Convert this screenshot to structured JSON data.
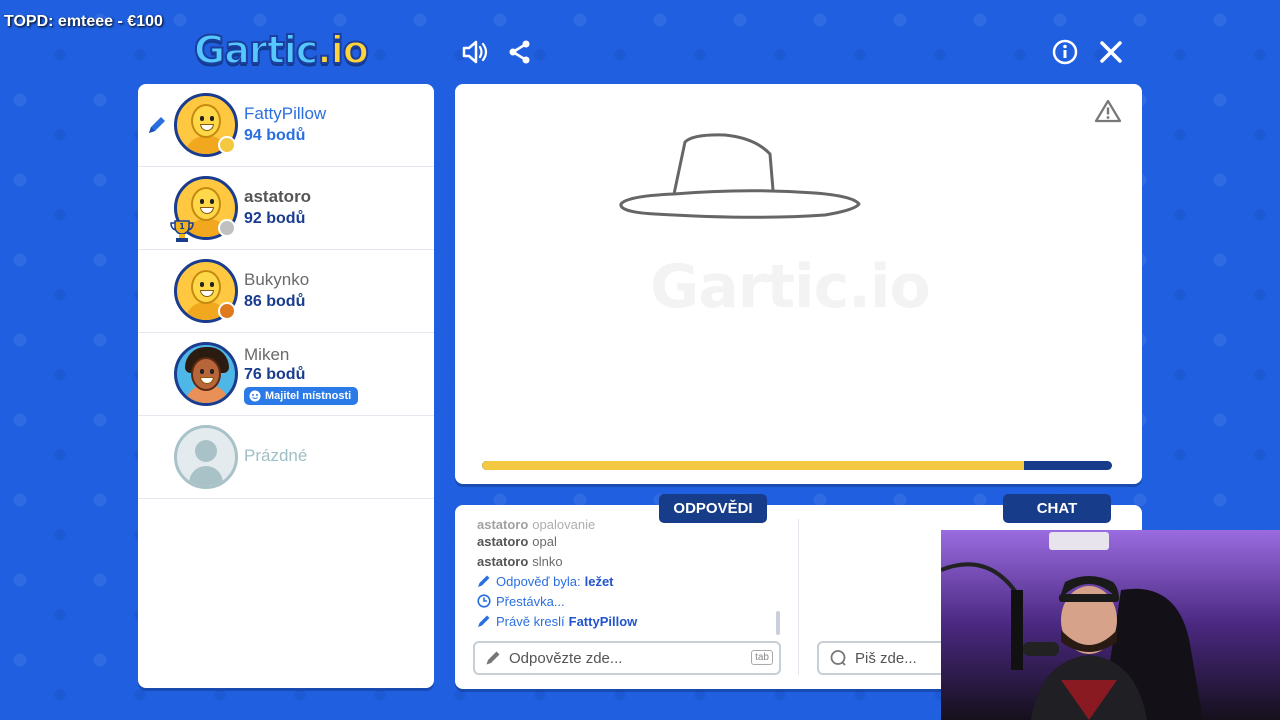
{
  "overlay": {
    "text": "TOPD: emteee - €100"
  },
  "header": {
    "logo_main": "Gartic",
    "logo_suffix": ".io"
  },
  "players": [
    {
      "name": "FattyPillow",
      "score": "94 bodů",
      "drawing": true,
      "status_color": "#f5c842"
    },
    {
      "name": "astatoro",
      "score": "92 bodů",
      "rank": "1",
      "status_color": "#c0c0c0"
    },
    {
      "name": "Bukynko",
      "score": "86 bodů",
      "status_color": "#e07a1e"
    },
    {
      "name": "Miken",
      "score": "76 bodů",
      "badge": "Majitel místnosti"
    },
    {
      "name": "Prázdné"
    }
  ],
  "canvas": {
    "watermark": "Gartic.io",
    "timer_progress": 0.86
  },
  "tabs": {
    "answers": "ODPOVĚDI",
    "chat": "CHAT"
  },
  "answers": [
    {
      "who": "astatoro",
      "text": "opalovanie"
    },
    {
      "who": "astatoro",
      "text": "opal"
    },
    {
      "who": "astatoro",
      "text": "slnko"
    },
    {
      "system": "Odpověď byla:",
      "value": "ležet",
      "icon": "pencil-icon"
    },
    {
      "system": "Přestávka...",
      "icon": "clock-icon"
    },
    {
      "system": "Právě kreslí",
      "value": "FattyPillow",
      "icon": "pencil-icon"
    }
  ],
  "answer_input": {
    "placeholder": "Odpovězte zde...",
    "key_hint": "tab"
  },
  "chat_input": {
    "placeholder": "Piš zde..."
  },
  "colors": {
    "background": "#1f5fe0",
    "navy": "#173c8a",
    "accent": "#2a6fe0",
    "timer": "#f5c842"
  }
}
